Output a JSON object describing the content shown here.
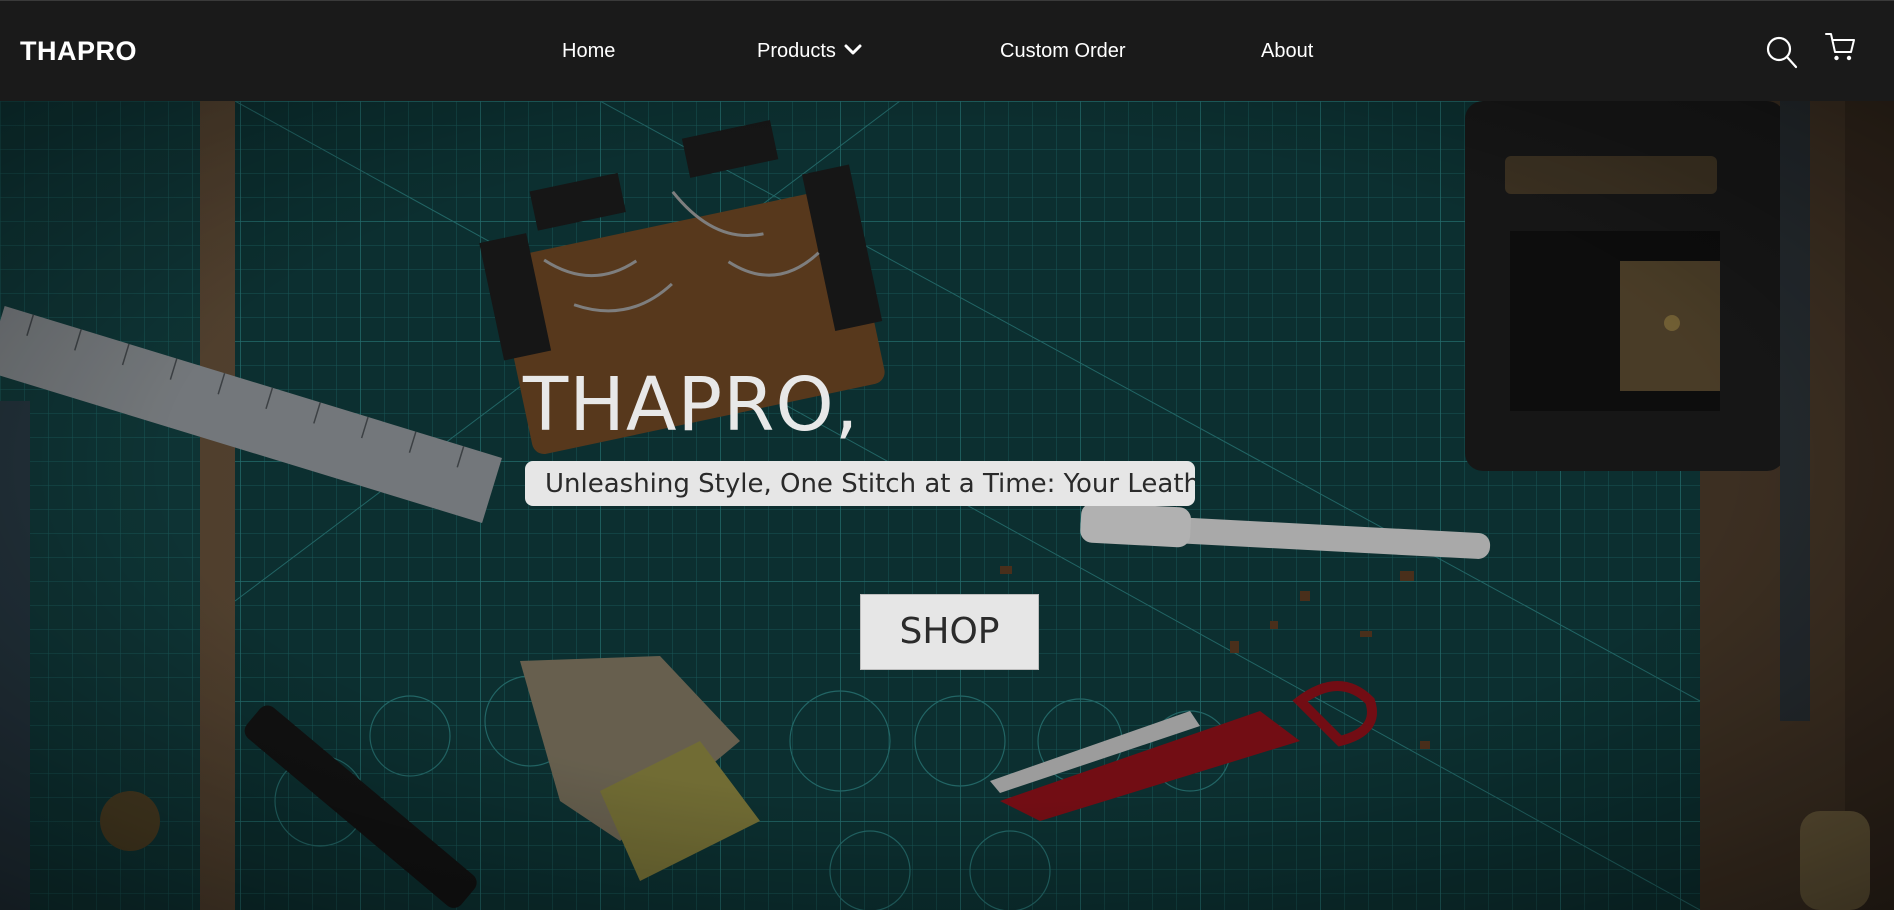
{
  "brand": "THAPRO",
  "nav": {
    "home": "Home",
    "products": "Products",
    "custom_order": "Custom Order",
    "about": "About"
  },
  "icons": {
    "search": "search-icon",
    "cart": "cart-icon",
    "products_dropdown": "chevron-down-icon"
  },
  "hero": {
    "title": "THAPRO,",
    "tagline": "Unleashing Style, One Stitch at a Time: Your Leathe",
    "button_label": "SHOP"
  },
  "colors": {
    "navbar_bg": "#1a1a1a",
    "cutting_mat": "#0f3a3b",
    "button_bg": "#e6e6e6",
    "scissors_red": "#8c1119"
  }
}
